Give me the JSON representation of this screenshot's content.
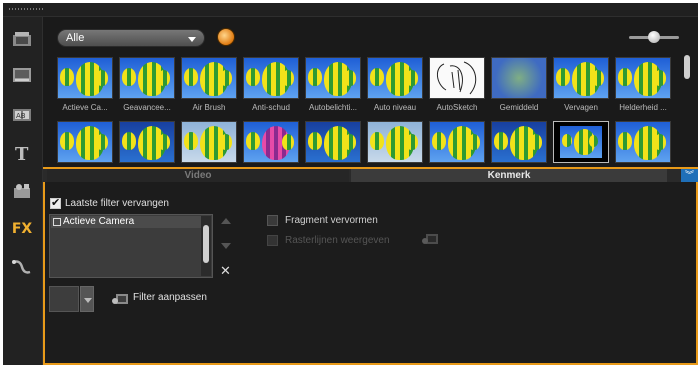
{
  "library": {
    "category_label": "Alle",
    "thumbnails_row1": [
      {
        "label": "Actieve Ca...",
        "style": "stripe"
      },
      {
        "label": "Geavanceе...",
        "style": "stripe"
      },
      {
        "label": "Air Brush",
        "style": "stripe"
      },
      {
        "label": "Anti-schud",
        "style": "stripe"
      },
      {
        "label": "Autobelichti...",
        "style": "stripe"
      },
      {
        "label": "Auto niveau",
        "style": "stripe"
      },
      {
        "label": "AutoSketch",
        "style": "sketch"
      },
      {
        "label": "Gemiddeld",
        "style": "blur"
      },
      {
        "label": "Vervagen",
        "style": "stripe"
      },
      {
        "label": "Helderheid ...",
        "style": "stripe"
      }
    ],
    "thumbnails_row2": [
      {
        "style": "stripe"
      },
      {
        "style": "stripe"
      },
      {
        "style": "pale"
      },
      {
        "style": "pink"
      },
      {
        "style": "stripe"
      },
      {
        "style": "pale"
      },
      {
        "style": "stripe"
      },
      {
        "style": "stripe"
      },
      {
        "style": "framed"
      },
      {
        "style": "stripe"
      }
    ]
  },
  "tabs": {
    "video": "Video",
    "kenmerk": "Kenmerk"
  },
  "options": {
    "replace_last_filter": "Laatste filter vervangen",
    "replace_last_filter_checked": true,
    "applied_filter": "Actieve Camera",
    "distort_clip": "Fragment vervormen",
    "show_grid": "Rasterlijnen weergeven",
    "customize_filter": "Filter aanpassen"
  },
  "sidebar": {
    "icons": [
      "media-icon",
      "instant-project-icon",
      "transition-icon",
      "title-icon",
      "graphic-icon",
      "fx-icon",
      "path-icon"
    ],
    "fx_label": "FX"
  },
  "colors": {
    "accent": "#e89a19",
    "tab_active": "#3b3b3b",
    "collapse_button": "#1f6fb8"
  }
}
